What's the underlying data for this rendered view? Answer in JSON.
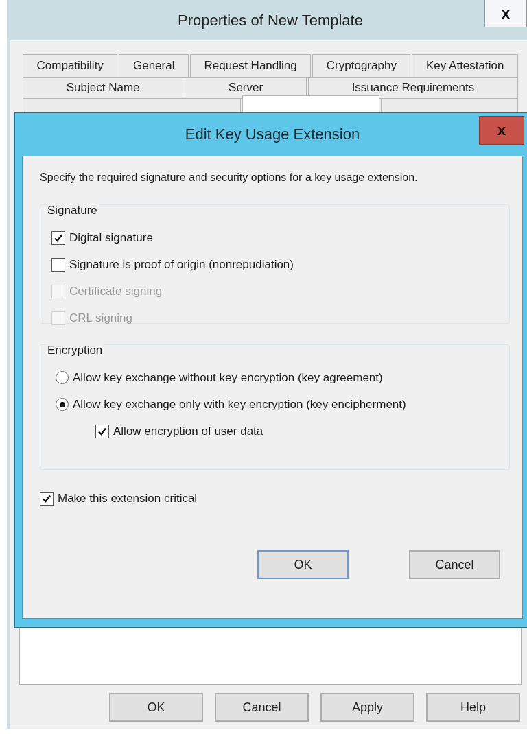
{
  "window": {
    "title": "Properties of New Template",
    "close": "x"
  },
  "tab_rows": [
    [
      {
        "label": "Compatibility",
        "selected": false
      },
      {
        "label": "General",
        "selected": false
      },
      {
        "label": "Request Handling",
        "selected": false
      },
      {
        "label": "Cryptography",
        "selected": false
      },
      {
        "label": "Key Attestation",
        "selected": false
      }
    ],
    [
      {
        "label": "Subject Name",
        "selected": false
      },
      {
        "label": "Server",
        "selected": false
      },
      {
        "label": "Issuance Requirements",
        "selected": false
      }
    ],
    [
      {
        "selected": false
      },
      {
        "selected": true
      },
      {
        "selected": false
      }
    ]
  ],
  "dialog": {
    "title": "Edit Key Usage Extension",
    "close": "x",
    "description": "Specify the required signature and security options for a key usage extension.",
    "groups": [
      {
        "label": "Signature",
        "options": [
          {
            "kind": "checkbox",
            "label": "Digital signature",
            "checked": true,
            "disabled": false
          },
          {
            "kind": "checkbox",
            "label": "Signature is proof of origin (nonrepudiation)",
            "checked": false,
            "disabled": false
          },
          {
            "kind": "checkbox",
            "label": "Certificate signing",
            "checked": false,
            "disabled": true
          },
          {
            "kind": "checkbox",
            "label": "CRL signing",
            "checked": false,
            "disabled": true
          }
        ]
      },
      {
        "label": "Encryption",
        "options": [
          {
            "kind": "radio",
            "label": "Allow key exchange without key encryption (key agreement)",
            "selected": false,
            "disabled": false
          },
          {
            "kind": "radio",
            "label": "Allow key exchange only with key encryption (key encipherment)",
            "selected": true,
            "disabled": false,
            "children": [
              {
                "kind": "checkbox",
                "label": "Allow encryption of user data",
                "checked": true,
                "disabled": false
              }
            ]
          }
        ]
      }
    ],
    "critical": {
      "kind": "checkbox",
      "label": "Make this extension critical",
      "checked": true,
      "disabled": false
    },
    "buttons": [
      {
        "label": "OK",
        "default": true
      },
      {
        "label": "Cancel",
        "default": false
      }
    ]
  },
  "buttons": [
    {
      "label": "OK",
      "default": false
    },
    {
      "label": "Cancel",
      "default": false
    },
    {
      "label": "Apply",
      "default": false
    },
    {
      "label": "Help",
      "default": false
    }
  ]
}
